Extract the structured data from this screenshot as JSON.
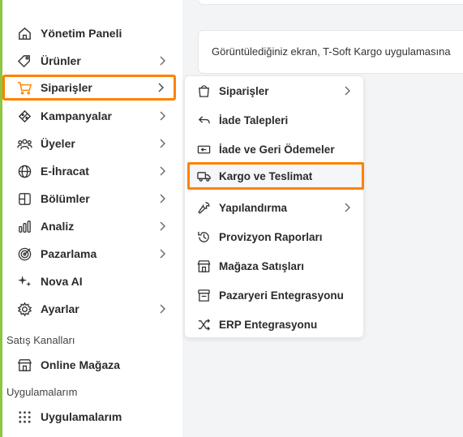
{
  "sidebar": {
    "items": [
      {
        "label": "Yönetim Paneli",
        "icon": "home-icon",
        "chevron": false
      },
      {
        "label": "Ürünler",
        "icon": "tag-icon",
        "chevron": true
      },
      {
        "label": "Siparişler",
        "icon": "cart-icon",
        "chevron": true
      },
      {
        "label": "Kampanyalar",
        "icon": "discount-icon",
        "chevron": true
      },
      {
        "label": "Üyeler",
        "icon": "users-icon",
        "chevron": true
      },
      {
        "label": "E-İhracat",
        "icon": "globe-icon",
        "chevron": true
      },
      {
        "label": "Bölümler",
        "icon": "sections-icon",
        "chevron": true
      },
      {
        "label": "Analiz",
        "icon": "analytics-icon",
        "chevron": true
      },
      {
        "label": "Pazarlama",
        "icon": "target-icon",
        "chevron": true
      },
      {
        "label": "Nova AI",
        "icon": "sparkle-icon",
        "chevron": false
      },
      {
        "label": "Ayarlar",
        "icon": "gear-icon",
        "chevron": true
      }
    ],
    "sales_channels_heading": "Satış Kanalları",
    "online_store_label": "Online Mağaza",
    "apps_heading": "Uygulamalarım",
    "apps_label": "Uygulamalarım",
    "accent_color": "#8dc63f",
    "highlight_color": "#ff8200",
    "cart_icon_color": "#ff8200"
  },
  "main": {
    "info_text": "Görüntülediğiniz ekran, T-Soft Kargo uygulamasına"
  },
  "submenu": {
    "items": [
      {
        "label": "Siparişler",
        "icon": "bag-icon",
        "chevron": true
      },
      {
        "label": "İade Talepleri",
        "icon": "return-arrow-icon",
        "chevron": false
      },
      {
        "label": "İade ve Geri Ödemeler",
        "icon": "money-icon",
        "chevron": false
      },
      {
        "label": "Kargo ve Teslimat",
        "icon": "truck-icon",
        "chevron": false
      },
      {
        "label": "Yapılandırma",
        "icon": "wrench-icon",
        "chevron": true
      },
      {
        "label": "Provizyon Raporları",
        "icon": "history-icon",
        "chevron": false
      },
      {
        "label": "Mağaza Satışları",
        "icon": "store-icon",
        "chevron": false
      },
      {
        "label": "Pazaryeri Entegrasyonu",
        "icon": "marketplace-icon",
        "chevron": false
      },
      {
        "label": "ERP Entegrasyonu",
        "icon": "shuffle-icon",
        "chevron": false
      }
    ]
  }
}
